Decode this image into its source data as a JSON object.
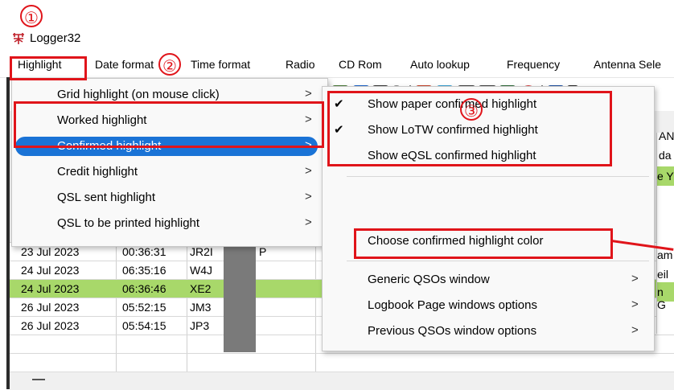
{
  "window": {
    "title": "Logger32"
  },
  "menubar": {
    "items": [
      "Highlight",
      "Date format",
      "Time format",
      "Radio",
      "CD Rom",
      "Auto lookup",
      "Frequency",
      "Antenna Sele"
    ]
  },
  "highlight_menu": {
    "items": [
      {
        "label": "Grid highlight (on mouse click)",
        "arrow": ">"
      },
      {
        "label": "Worked highlight",
        "arrow": ">"
      },
      {
        "label": "Confirmed highlight",
        "arrow": ">"
      },
      {
        "label": "Credit highlight",
        "arrow": ">"
      },
      {
        "label": "QSL sent highlight",
        "arrow": ">"
      },
      {
        "label": "QSL to be printed highlight",
        "arrow": ">"
      }
    ]
  },
  "confirmed_submenu": {
    "items": [
      {
        "label": "Show paper confirmed highlight",
        "check": "✔"
      },
      {
        "label": "Show LoTW confirmed highlight",
        "check": "✔"
      },
      {
        "label": "Show eQSL confirmed highlight",
        "check": ""
      },
      {
        "label": "Choose confirmed highlight color",
        "check": ""
      },
      {
        "label": "Generic QSOs window",
        "arrow": ">"
      },
      {
        "label": "Logbook Page windows options",
        "arrow": ">"
      },
      {
        "label": "Previous QSOs window options",
        "arrow": ">"
      }
    ]
  },
  "grid": {
    "rows": [
      {
        "date": "23 Jul 2023",
        "time": "00:36:31",
        "call": "JR2I",
        "extra": "P"
      },
      {
        "date": "24 Jul 2023",
        "time": "06:35:16",
        "call": "W4J",
        "extra": ""
      },
      {
        "date": "24 Jul 2023",
        "time": "06:36:46",
        "call": "XE2",
        "extra": ""
      },
      {
        "date": "26 Jul 2023",
        "time": "05:52:15",
        "call": "JM3",
        "extra": ""
      },
      {
        "date": "26 Jul 2023",
        "time": "05:54:15",
        "call": "JP3",
        "extra": ""
      }
    ]
  },
  "right_fragments": [
    "AN",
    "da",
    "e Y",
    "am",
    "eil",
    "n G"
  ],
  "annotations": {
    "one": "①",
    "two": "②",
    "three": "③"
  },
  "colors": {
    "highlight_green": "#a8d86a",
    "selection_blue": "#1a73d6",
    "annotation_red": "#e0141a"
  }
}
